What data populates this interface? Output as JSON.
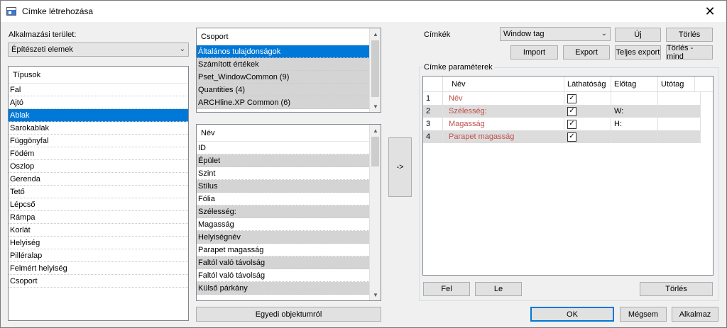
{
  "window": {
    "title": "Címke létrehozása",
    "close_glyph": "✕"
  },
  "area": {
    "label": "Alkalmazási terület:",
    "selected": "Építészeti elemek"
  },
  "types": {
    "header": "Típusok",
    "items": [
      "Fal",
      "Ajtó",
      "Ablak",
      "Sarokablak",
      "Függönyfal",
      "Födém",
      "Oszlop",
      "Gerenda",
      "Tető",
      "Lépcső",
      "Rámpa",
      "Korlát",
      "Helyiség",
      "Pilléralap",
      "Felmért helyiség",
      "Csoport"
    ],
    "selected_index": 2
  },
  "groups": {
    "header": "Csoport",
    "items": [
      "Általános tulajdonságok",
      "Számított értékek",
      "Pset_WindowCommon (9)",
      "Quantities (4)",
      "ARCHline.XP Common (6)"
    ],
    "selected_index": 0
  },
  "names": {
    "header": "Név",
    "items": [
      "ID",
      "Épület",
      "Szint",
      "Stílus",
      "Fólia",
      "Szélesség:",
      "Magasság",
      "Helyiségnév",
      "Parapet magasság",
      "Faltól való távolság",
      "Faltól való távolság",
      "Külső párkány"
    ]
  },
  "transfer_button": "->",
  "custom_object_button": "Egyedi objektumról",
  "labels": {
    "label": "Címkék",
    "selected": "Window tag",
    "new_button": "Új",
    "delete_button": "Törlés",
    "import_button": "Import",
    "export_button": "Export",
    "full_export_button": "Teljes export",
    "delete_all_button": "Törlés - mind"
  },
  "params": {
    "group_label": "Címke paraméterek",
    "columns": [
      "Név",
      "Láthatóság",
      "Előtag",
      "Utótag"
    ],
    "rows": [
      {
        "num": "1",
        "name": "Név",
        "visible": true,
        "prefix": "",
        "suffix": ""
      },
      {
        "num": "2",
        "name": "Szélesség:",
        "visible": true,
        "prefix": "W:",
        "suffix": ""
      },
      {
        "num": "3",
        "name": "Magasság",
        "visible": true,
        "prefix": "H:",
        "suffix": ""
      },
      {
        "num": "4",
        "name": "Parapet magasság",
        "visible": true,
        "prefix": "",
        "suffix": ""
      }
    ],
    "up_button": "Fel",
    "down_button": "Le",
    "delete_button": "Törlés"
  },
  "footer": {
    "ok": "OK",
    "cancel": "Mégsem",
    "apply": "Alkalmaz"
  },
  "colors": {
    "selection": "#0078d7",
    "param_name": "#c0504d"
  }
}
